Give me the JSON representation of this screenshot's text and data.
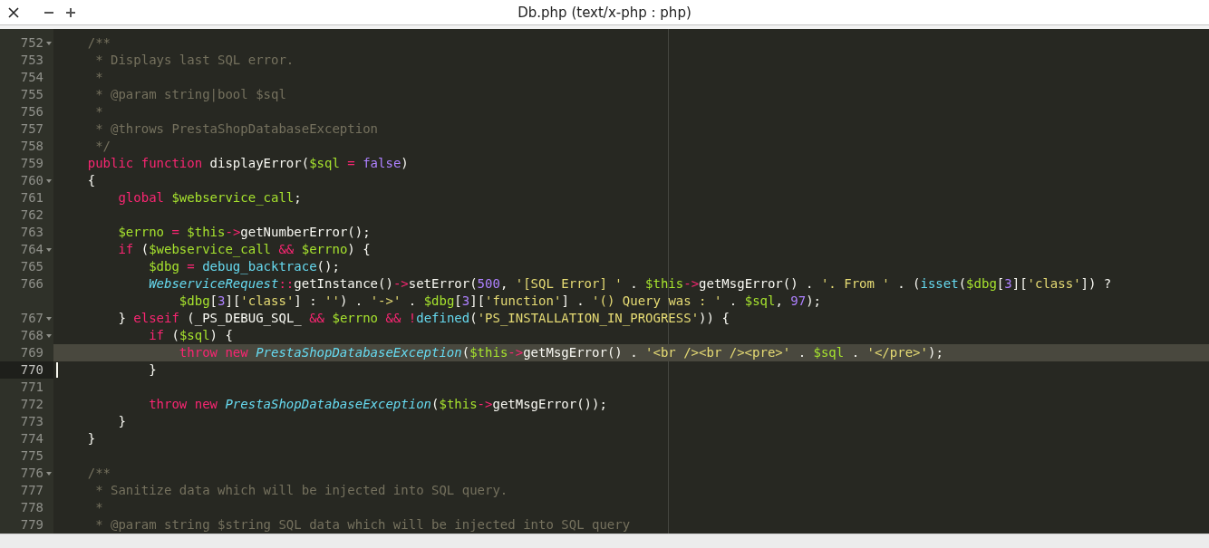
{
  "window": {
    "title": "Db.php (text/x-php : php)"
  },
  "lines": [
    {
      "number": "752",
      "fold": true,
      "highlighted": false,
      "cursor": false,
      "tokens": [
        {
          "kind": "c",
          "text": "    /**"
        }
      ]
    },
    {
      "number": "753",
      "fold": false,
      "highlighted": false,
      "cursor": false,
      "tokens": [
        {
          "kind": "c",
          "text": "     * Displays last SQL error."
        }
      ]
    },
    {
      "number": "754",
      "fold": false,
      "highlighted": false,
      "cursor": false,
      "tokens": [
        {
          "kind": "c",
          "text": "     *"
        }
      ]
    },
    {
      "number": "755",
      "fold": false,
      "highlighted": false,
      "cursor": false,
      "tokens": [
        {
          "kind": "c",
          "text": "     * @param string|bool $sql"
        }
      ]
    },
    {
      "number": "756",
      "fold": false,
      "highlighted": false,
      "cursor": false,
      "tokens": [
        {
          "kind": "c",
          "text": "     *"
        }
      ]
    },
    {
      "number": "757",
      "fold": false,
      "highlighted": false,
      "cursor": false,
      "tokens": [
        {
          "kind": "c",
          "text": "     * @throws PrestaShopDatabaseException"
        }
      ]
    },
    {
      "number": "758",
      "fold": false,
      "highlighted": false,
      "cursor": false,
      "tokens": [
        {
          "kind": "c",
          "text": "     */"
        }
      ]
    },
    {
      "number": "759",
      "fold": false,
      "highlighted": false,
      "cursor": false,
      "tokens": [
        {
          "kind": "k",
          "text": "    public function "
        },
        {
          "kind": "p",
          "text": "displayError("
        },
        {
          "kind": "v",
          "text": "$sql"
        },
        {
          "kind": "k",
          "text": " = "
        },
        {
          "kind": "n",
          "text": "false"
        },
        {
          "kind": "p",
          "text": ")"
        }
      ]
    },
    {
      "number": "760",
      "fold": true,
      "highlighted": false,
      "cursor": false,
      "tokens": [
        {
          "kind": "p",
          "text": "    {"
        }
      ]
    },
    {
      "number": "761",
      "fold": false,
      "highlighted": false,
      "cursor": false,
      "tokens": [
        {
          "kind": "k",
          "text": "        global "
        },
        {
          "kind": "v",
          "text": "$webservice_call"
        },
        {
          "kind": "p",
          "text": ";"
        }
      ]
    },
    {
      "number": "762",
      "fold": false,
      "highlighted": false,
      "cursor": false
    },
    {
      "number": "763",
      "fold": false,
      "highlighted": false,
      "cursor": false,
      "tokens": [
        {
          "kind": "v",
          "text": "        $errno"
        },
        {
          "kind": "k",
          "text": " = "
        },
        {
          "kind": "v",
          "text": "$this"
        },
        {
          "kind": "k",
          "text": "->"
        },
        {
          "kind": "p",
          "text": "getNumberError();"
        }
      ]
    },
    {
      "number": "764",
      "fold": true,
      "highlighted": false,
      "cursor": false,
      "tokens": [
        {
          "kind": "k",
          "text": "        if "
        },
        {
          "kind": "p",
          "text": "("
        },
        {
          "kind": "v",
          "text": "$webservice_call"
        },
        {
          "kind": "k",
          "text": " && "
        },
        {
          "kind": "v",
          "text": "$errno"
        },
        {
          "kind": "p",
          "text": ") {"
        }
      ]
    },
    {
      "number": "765",
      "fold": false,
      "highlighted": false,
      "cursor": false,
      "tokens": [
        {
          "kind": "v",
          "text": "            $dbg"
        },
        {
          "kind": "k",
          "text": " = "
        },
        {
          "kind": "f",
          "text": "debug_backtrace"
        },
        {
          "kind": "p",
          "text": "();"
        }
      ]
    },
    {
      "number": "766",
      "fold": false,
      "highlighted": false,
      "cursor": false,
      "tokens": [
        {
          "kind": "t",
          "text": "            WebserviceRequest"
        },
        {
          "kind": "k",
          "text": "::"
        },
        {
          "kind": "p",
          "text": "getInstance()"
        },
        {
          "kind": "k",
          "text": "->"
        },
        {
          "kind": "p",
          "text": "setError("
        },
        {
          "kind": "n",
          "text": "500"
        },
        {
          "kind": "p",
          "text": ", "
        },
        {
          "kind": "s",
          "text": "'[SQL Error] '"
        },
        {
          "kind": "p",
          "text": " . "
        },
        {
          "kind": "v",
          "text": "$this"
        },
        {
          "kind": "k",
          "text": "->"
        },
        {
          "kind": "p",
          "text": "getMsgError() . "
        },
        {
          "kind": "s",
          "text": "'. From '"
        },
        {
          "kind": "p",
          "text": " . ("
        },
        {
          "kind": "f",
          "text": "isset"
        },
        {
          "kind": "p",
          "text": "("
        },
        {
          "kind": "v",
          "text": "$dbg"
        },
        {
          "kind": "p",
          "text": "["
        },
        {
          "kind": "n",
          "text": "3"
        },
        {
          "kind": "p",
          "text": "]["
        },
        {
          "kind": "s",
          "text": "'class'"
        },
        {
          "kind": "p",
          "text": "]) ?"
        }
      ],
      "wrap_tokens": [
        {
          "kind": "v",
          "text": "                $dbg"
        },
        {
          "kind": "p",
          "text": "["
        },
        {
          "kind": "n",
          "text": "3"
        },
        {
          "kind": "p",
          "text": "]["
        },
        {
          "kind": "s",
          "text": "'class'"
        },
        {
          "kind": "p",
          "text": "] : "
        },
        {
          "kind": "s",
          "text": "''"
        },
        {
          "kind": "p",
          "text": ") . "
        },
        {
          "kind": "s",
          "text": "'->'"
        },
        {
          "kind": "p",
          "text": " . "
        },
        {
          "kind": "v",
          "text": "$dbg"
        },
        {
          "kind": "p",
          "text": "["
        },
        {
          "kind": "n",
          "text": "3"
        },
        {
          "kind": "p",
          "text": "]["
        },
        {
          "kind": "s",
          "text": "'function'"
        },
        {
          "kind": "p",
          "text": "] . "
        },
        {
          "kind": "s",
          "text": "'() Query was : '"
        },
        {
          "kind": "p",
          "text": " . "
        },
        {
          "kind": "v",
          "text": "$sql"
        },
        {
          "kind": "p",
          "text": ", "
        },
        {
          "kind": "n",
          "text": "97"
        },
        {
          "kind": "p",
          "text": ");"
        }
      ]
    },
    {
      "number": "767",
      "fold": true,
      "highlighted": false,
      "cursor": false,
      "tokens": [
        {
          "kind": "p",
          "text": "        } "
        },
        {
          "kind": "k",
          "text": "elseif "
        },
        {
          "kind": "p",
          "text": "(_PS_DEBUG_SQL_ "
        },
        {
          "kind": "k",
          "text": "&& "
        },
        {
          "kind": "v",
          "text": "$errno "
        },
        {
          "kind": "k",
          "text": "&& !"
        },
        {
          "kind": "f",
          "text": "defined"
        },
        {
          "kind": "p",
          "text": "("
        },
        {
          "kind": "s",
          "text": "'PS_INSTALLATION_IN_PROGRESS'"
        },
        {
          "kind": "p",
          "text": ")) {"
        }
      ]
    },
    {
      "number": "768",
      "fold": true,
      "highlighted": false,
      "cursor": false,
      "tokens": [
        {
          "kind": "k",
          "text": "            if "
        },
        {
          "kind": "p",
          "text": "("
        },
        {
          "kind": "v",
          "text": "$sql"
        },
        {
          "kind": "p",
          "text": ") {"
        }
      ]
    },
    {
      "number": "769",
      "fold": false,
      "highlighted": true,
      "cursor": false,
      "tokens": [
        {
          "kind": "k",
          "text": "                throw new "
        },
        {
          "kind": "t",
          "text": "PrestaShopDatabaseException"
        },
        {
          "kind": "p",
          "text": "("
        },
        {
          "kind": "v",
          "text": "$this"
        },
        {
          "kind": "k",
          "text": "->"
        },
        {
          "kind": "p",
          "text": "getMsgError() . "
        },
        {
          "kind": "s",
          "text": "'<br /><br /><pre>'"
        },
        {
          "kind": "p",
          "text": " . "
        },
        {
          "kind": "v",
          "text": "$sql"
        },
        {
          "kind": "p",
          "text": " . "
        },
        {
          "kind": "s",
          "text": "'</pre>'"
        },
        {
          "kind": "p",
          "text": ");"
        }
      ]
    },
    {
      "number": "770",
      "fold": false,
      "highlighted": false,
      "cursor": true,
      "tokens": [
        {
          "kind": "p",
          "text": "            }"
        }
      ]
    },
    {
      "number": "771",
      "fold": false,
      "highlighted": false,
      "cursor": false
    },
    {
      "number": "772",
      "fold": false,
      "highlighted": false,
      "cursor": false,
      "tokens": [
        {
          "kind": "k",
          "text": "            throw new "
        },
        {
          "kind": "t",
          "text": "PrestaShopDatabaseException"
        },
        {
          "kind": "p",
          "text": "("
        },
        {
          "kind": "v",
          "text": "$this"
        },
        {
          "kind": "k",
          "text": "->"
        },
        {
          "kind": "p",
          "text": "getMsgError());"
        }
      ]
    },
    {
      "number": "773",
      "fold": false,
      "highlighted": false,
      "cursor": false,
      "tokens": [
        {
          "kind": "p",
          "text": "        }"
        }
      ]
    },
    {
      "number": "774",
      "fold": false,
      "highlighted": false,
      "cursor": false,
      "tokens": [
        {
          "kind": "p",
          "text": "    }"
        }
      ]
    },
    {
      "number": "775",
      "fold": false,
      "highlighted": false,
      "cursor": false
    },
    {
      "number": "776",
      "fold": true,
      "highlighted": false,
      "cursor": false,
      "tokens": [
        {
          "kind": "c",
          "text": "    /**"
        }
      ]
    },
    {
      "number": "777",
      "fold": false,
      "highlighted": false,
      "cursor": false,
      "tokens": [
        {
          "kind": "c",
          "text": "     * Sanitize data which will be injected into SQL query."
        }
      ]
    },
    {
      "number": "778",
      "fold": false,
      "highlighted": false,
      "cursor": false,
      "tokens": [
        {
          "kind": "c",
          "text": "     *"
        }
      ]
    },
    {
      "number": "779",
      "fold": false,
      "highlighted": false,
      "cursor": false,
      "tokens": [
        {
          "kind": "c",
          "text": "     * @param string $string SQL data which will be injected into SQL query"
        }
      ]
    }
  ]
}
